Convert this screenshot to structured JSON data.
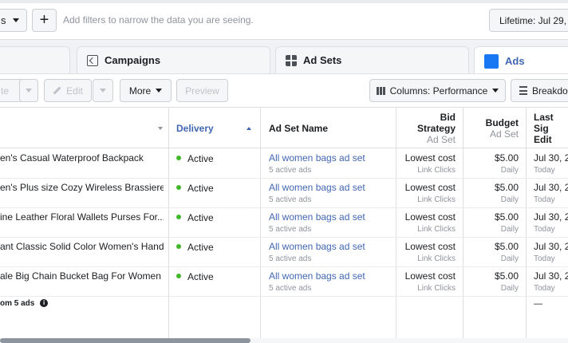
{
  "filter_bar": {
    "dropdown_label": "s",
    "add_button": "+",
    "filter_hint": "Add filters to narrow the data you are seeing.",
    "date_range": "Lifetime: Jul 29, 2"
  },
  "tabs": [
    {
      "label": "Campaigns"
    },
    {
      "label": "Ad Sets"
    },
    {
      "label": "Ads"
    }
  ],
  "toolbar": {
    "duplicate_label": "te",
    "edit_label": "Edit",
    "more_label": "More",
    "preview_label": "Preview",
    "columns_label": "Columns: Performance",
    "breakdown_label": "Breakdo"
  },
  "table": {
    "headers": {
      "delivery": "Delivery",
      "adset_name": "Ad Set Name",
      "bid_strategy_1": "Bid",
      "bid_strategy_2": "Strategy",
      "bid_strategy_sub": "Ad Set",
      "budget": "Budget",
      "budget_sub": "Ad Set",
      "last_sig_1": "Last Sig",
      "last_sig_2": "Edit"
    },
    "rows": [
      {
        "name": "en's Casual Waterproof Backpack",
        "delivery": "Active",
        "adset": "All women bags ad set",
        "adset_sub": "5 active ads",
        "bid": "Lowest cost",
        "bid_sub": "Link Clicks",
        "budget": "$5.00",
        "budget_sub": "Daily",
        "last": "Jul 30, 2",
        "last_sub": "Today"
      },
      {
        "name": "en's Plus size Cozy Wireless Brassiere",
        "delivery": "Active",
        "adset": "All women bags ad set",
        "adset_sub": "5 active ads",
        "bid": "Lowest cost",
        "bid_sub": "Link Clicks",
        "budget": "$5.00",
        "budget_sub": "Daily",
        "last": "Jul 30, 2",
        "last_sub": "Today"
      },
      {
        "name": "ine Leather Floral Wallets Purses For...",
        "delivery": "Active",
        "adset": "All women bags ad set",
        "adset_sub": "5 active ads",
        "bid": "Lowest cost",
        "bid_sub": "Link Clicks",
        "budget": "$5.00",
        "budget_sub": "Daily",
        "last": "Jul 30, 2",
        "last_sub": "Today"
      },
      {
        "name": "ant Classic Solid Color Women's Hand...",
        "delivery": "Active",
        "adset": "All women bags ad set",
        "adset_sub": "5 active ads",
        "bid": "Lowest cost",
        "bid_sub": "Link Clicks",
        "budget": "$5.00",
        "budget_sub": "Daily",
        "last": "Jul 30, 2",
        "last_sub": "Today"
      },
      {
        "name": "ale Big Chain Bucket Bag For Women",
        "delivery": "Active",
        "adset": "All women bags ad set",
        "adset_sub": "5 active ads",
        "bid": "Lowest cost",
        "bid_sub": "Link Clicks",
        "budget": "$5.00",
        "budget_sub": "Daily",
        "last": "Jul 30, 2",
        "last_sub": "Today"
      }
    ],
    "summary": {
      "label": "om 5 ads",
      "info_icon": "i",
      "last": "—"
    }
  },
  "colors": {
    "accent": "#4267b2",
    "active_dot": "#42b72a",
    "ads_tab_icon": "#1877f2"
  }
}
